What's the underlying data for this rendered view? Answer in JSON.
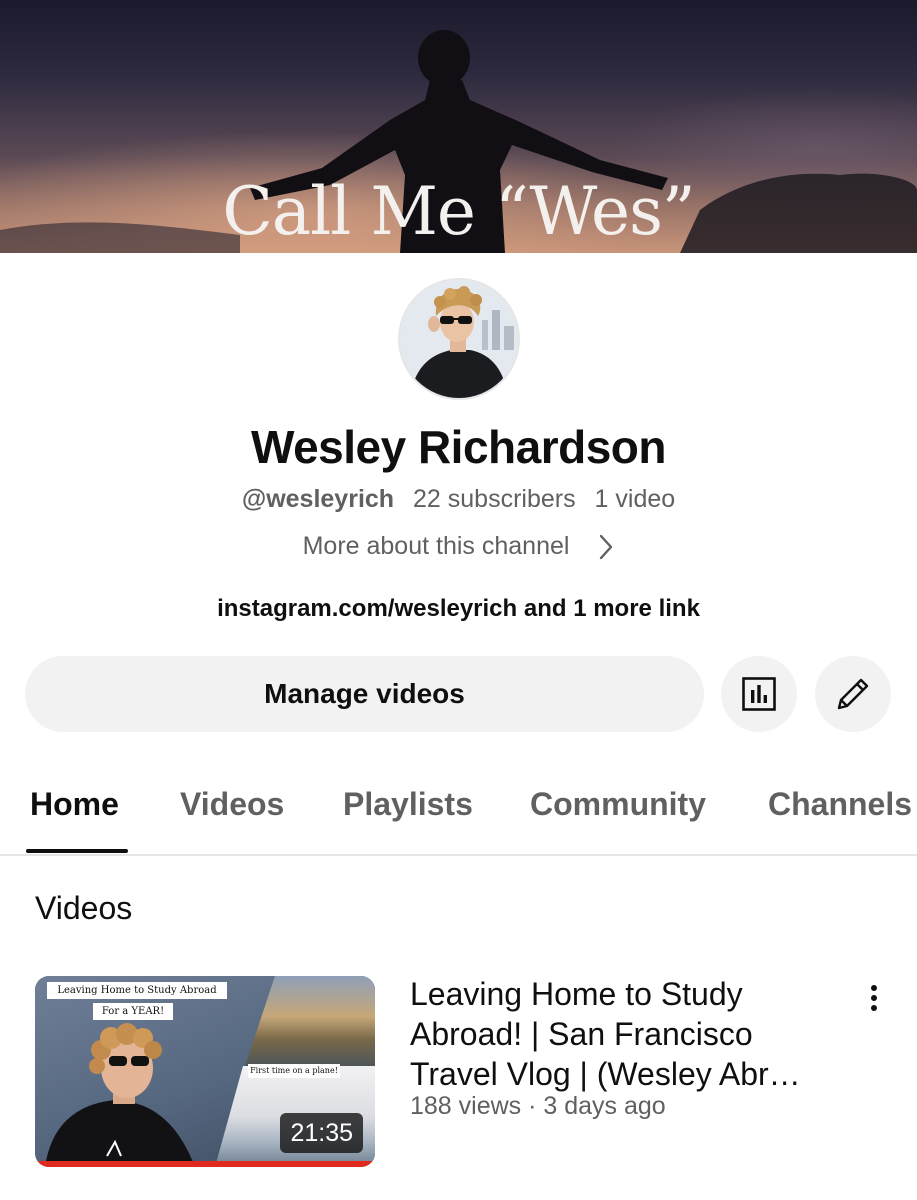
{
  "banner": {
    "title": "Call Me “Wes”"
  },
  "channel": {
    "name": "Wesley Richardson",
    "handle": "@wesleyrich",
    "subscribers": "22 subscribers",
    "video_count": "1 video",
    "more_about": "More about this channel",
    "links": "instagram.com/wesleyrich and 1 more link"
  },
  "actions": {
    "manage_videos": "Manage videos",
    "stats_icon": "bar-chart-icon",
    "edit_icon": "pencil-icon"
  },
  "tabs": [
    {
      "label": "Home",
      "active": true
    },
    {
      "label": "Videos"
    },
    {
      "label": "Playlists"
    },
    {
      "label": "Community"
    },
    {
      "label": "Channels"
    }
  ],
  "section": {
    "title": "Videos"
  },
  "videos": [
    {
      "title": "Leaving Home to Study Abroad! | San Francisco Travel Vlog | (Wesley Abr…",
      "meta": "188 views · 3 days ago",
      "duration": "21:35",
      "thumb_text_1": "Leaving Home to Study Abroad",
      "thumb_text_2": "For a YEAR!",
      "thumb_text_3": "First time on a plane!",
      "watched_fraction": 1.0
    }
  ],
  "colors": {
    "text_primary": "#0f0f0f",
    "text_secondary": "#606060",
    "button_bg": "#f2f2f2",
    "progress_red": "#e02a1f"
  }
}
